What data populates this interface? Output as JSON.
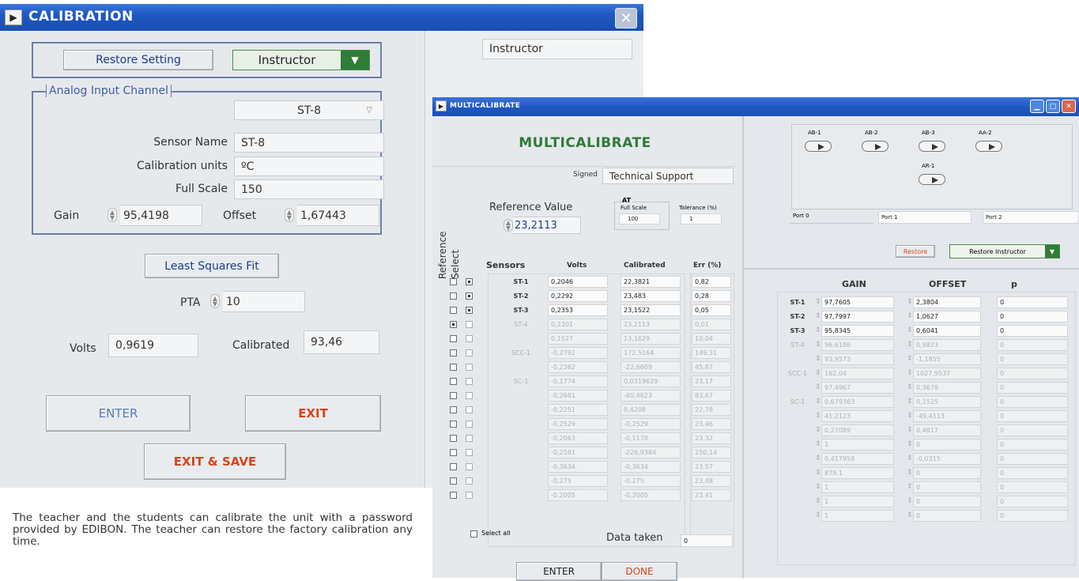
{
  "calibration": {
    "title": "CALIBRATION",
    "restore_btn": "Restore Setting",
    "user_select": "Instructor",
    "right_field": "Instructor",
    "group_label": "Analog Input Channel",
    "channel_select": "ST-8",
    "sensor_name_label": "Sensor Name",
    "sensor_name": "ST-8",
    "units_label": "Calibration units",
    "units": "ºC",
    "fullscale_label": "Full Scale",
    "fullscale": "150",
    "gain_label": "Gain",
    "gain": "95,4198",
    "offset_label": "Offset",
    "offset": "1,67443",
    "lsf_btn": "Least Squares Fit",
    "pta_label": "PTA",
    "pta": "10",
    "volts_label": "Volts",
    "volts": "0,9619",
    "calibrated_label": "Calibrated",
    "calibrated": "93,46",
    "enter_btn": "ENTER",
    "exit_btn": "EXIT",
    "exit_save_btn": "EXIT & SAVE"
  },
  "caption": "The teacher and the students can calibrate the unit with a password provided by EDIBON. The teacher can restore the factory calibration any time.",
  "multi": {
    "title": "MULTICALIBRATE",
    "heading": "MULTICALIBRATE",
    "signed_label": "Signed",
    "signed": "Technical Support",
    "reference_vertical": "Reference",
    "select_vertical": "Select",
    "ref_value_label": "Reference Value",
    "ref_value": "23,2113",
    "at_label": "AT",
    "fullscale_label": "Full Scale",
    "fullscale": "100",
    "tolerance_label": "Tolerance (%)",
    "tolerance": "1",
    "col_sensors": "Sensors",
    "col_volts": "Volts",
    "col_calibrated": "Calibrated",
    "col_err": "Err (%)",
    "rows": [
      {
        "ref": false,
        "sel": true,
        "name": "ST-1",
        "volts": "0,2046",
        "cal": "22,3821",
        "err": "0,82",
        "active": true
      },
      {
        "ref": false,
        "sel": true,
        "name": "ST-2",
        "volts": "0,2292",
        "cal": "23,483",
        "err": "0,28",
        "active": true
      },
      {
        "ref": false,
        "sel": true,
        "name": "ST-3",
        "volts": "0,2353",
        "cal": "23,1522",
        "err": "0,05",
        "active": true
      },
      {
        "ref": true,
        "sel": false,
        "name": "ST-4",
        "volts": "0,2301",
        "cal": "23,2113",
        "err": "0,01",
        "active": false
      },
      {
        "ref": false,
        "sel": false,
        "name": "",
        "volts": "0,1527",
        "cal": "13,1629",
        "err": "10,04",
        "active": false
      },
      {
        "ref": false,
        "sel": false,
        "name": "SCC-1",
        "volts": "-0,2792",
        "cal": "172,5164",
        "err": "149,31",
        "active": false
      },
      {
        "ref": false,
        "sel": false,
        "name": "",
        "volts": "-0,2362",
        "cal": "-22,6609",
        "err": "45,87",
        "active": false
      },
      {
        "ref": false,
        "sel": false,
        "name": "SC-1",
        "volts": "-0,1774",
        "cal": "0,0319629",
        "err": "23,17",
        "active": false
      },
      {
        "ref": false,
        "sel": false,
        "name": "",
        "volts": "-0,2681",
        "cal": "-60,4623",
        "err": "83,67",
        "active": false
      },
      {
        "ref": false,
        "sel": false,
        "name": "",
        "volts": "-0,2251",
        "cal": "0,4208",
        "err": "22,78",
        "active": false
      },
      {
        "ref": false,
        "sel": false,
        "name": "",
        "volts": "-0,2529",
        "cal": "-0,2529",
        "err": "23,46",
        "active": false
      },
      {
        "ref": false,
        "sel": false,
        "name": "",
        "volts": "-0,2063",
        "cal": "-0,1178",
        "err": "23,32",
        "active": false
      },
      {
        "ref": false,
        "sel": false,
        "name": "",
        "volts": "-0,2581",
        "cal": "-226,9384",
        "err": "250,14",
        "active": false
      },
      {
        "ref": false,
        "sel": false,
        "name": "",
        "volts": "-0,3634",
        "cal": "-0,3634",
        "err": "23,57",
        "active": false
      },
      {
        "ref": false,
        "sel": false,
        "name": "",
        "volts": "-0,275",
        "cal": "-0,275",
        "err": "23,48",
        "active": false
      },
      {
        "ref": false,
        "sel": false,
        "name": "",
        "volts": "-0,2005",
        "cal": "-0,2005",
        "err": "23,41",
        "active": false
      }
    ],
    "select_all": "Select all",
    "data_taken_label": "Data taken",
    "data_taken": "0",
    "enter_btn": "ENTER",
    "done_btn": "DONE",
    "switches": [
      {
        "label": "AB-1"
      },
      {
        "label": "AB-2"
      },
      {
        "label": "AB-3"
      },
      {
        "label": "AA-2"
      },
      {
        "label": "AR-1"
      }
    ],
    "ports": [
      "Port 0",
      "Port 1",
      "Port 2"
    ],
    "restore_btn": "Restore",
    "restore_select": "Restore Instructor",
    "col_gain": "GAIN",
    "col_offset": "OFFSET",
    "col_p": "p",
    "gain_rows": [
      {
        "name": "ST-1",
        "gain": "97,7605",
        "offset": "2,3804",
        "p": "0",
        "active": true
      },
      {
        "name": "ST-2",
        "gain": "97,7997",
        "offset": "1,0627",
        "p": "0",
        "active": true
      },
      {
        "name": "ST-3",
        "gain": "95,8345",
        "offset": "0,6041",
        "p": "0",
        "active": true
      },
      {
        "name": "ST-4",
        "gain": "96,6186",
        "offset": "0,9823",
        "p": "0",
        "active": false
      },
      {
        "name": "",
        "gain": "93,9573",
        "offset": "-1,1855",
        "p": "0",
        "active": false
      },
      {
        "name": "SCC-1",
        "gain": "162,04",
        "offset": "1027,9537",
        "p": "0",
        "active": false
      },
      {
        "name": "",
        "gain": "97,4967",
        "offset": "0,3678",
        "p": "0",
        "active": false
      },
      {
        "name": "SC-1",
        "gain": "0,679363",
        "offset": "0,1525",
        "p": "0",
        "active": false
      },
      {
        "name": "",
        "gain": "41,2123",
        "offset": "-49,4113",
        "p": "0",
        "active": false
      },
      {
        "name": "",
        "gain": "0,27089",
        "offset": "0,4817",
        "p": "0",
        "active": false
      },
      {
        "name": "",
        "gain": "1",
        "offset": "0",
        "p": "0",
        "active": false
      },
      {
        "name": "",
        "gain": "0,417958",
        "offset": "-0,0315",
        "p": "0",
        "active": false
      },
      {
        "name": "",
        "gain": "879,1",
        "offset": "0",
        "p": "0",
        "active": false
      },
      {
        "name": "",
        "gain": "1",
        "offset": "0",
        "p": "0",
        "active": false
      },
      {
        "name": "",
        "gain": "1",
        "offset": "0",
        "p": "0",
        "active": false
      },
      {
        "name": "",
        "gain": "1",
        "offset": "0",
        "p": "0",
        "active": false
      }
    ]
  }
}
